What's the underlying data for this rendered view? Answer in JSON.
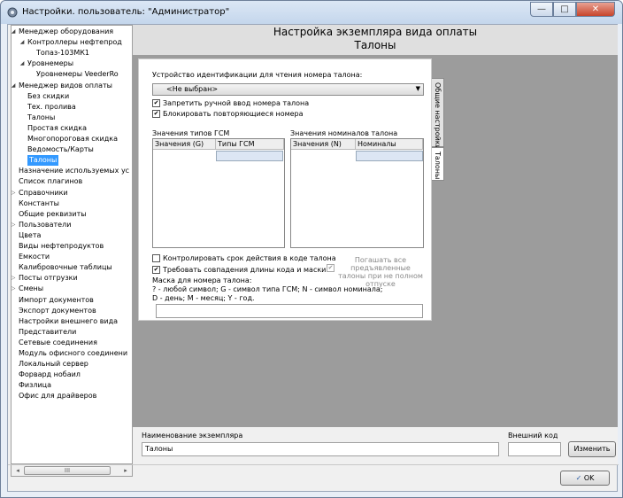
{
  "window": {
    "title": "Настройки. пользователь: \"Администратор\""
  },
  "tree": {
    "items": [
      {
        "label": "Менеджер оборудования",
        "level": 0,
        "twisty": "◢"
      },
      {
        "label": "Контроллеры нефтепрод",
        "level": 1,
        "twisty": "◢"
      },
      {
        "label": "Топаз-103МК1",
        "level": 2,
        "twisty": ""
      },
      {
        "label": "Уровнемеры",
        "level": 1,
        "twisty": "◢"
      },
      {
        "label": "Уровнемеры VeederRo",
        "level": 2,
        "twisty": ""
      },
      {
        "label": "Менеджер видов оплаты",
        "level": 0,
        "twisty": "◢"
      },
      {
        "label": "Без скидки",
        "level": 1,
        "twisty": ""
      },
      {
        "label": "Тех. пролива",
        "level": 1,
        "twisty": ""
      },
      {
        "label": "Талоны",
        "level": 1,
        "twisty": ""
      },
      {
        "label": "Простая скидка",
        "level": 1,
        "twisty": ""
      },
      {
        "label": "Многопороговая скидка",
        "level": 1,
        "twisty": ""
      },
      {
        "label": "Ведомость/Карты",
        "level": 1,
        "twisty": ""
      },
      {
        "label": "Талоны",
        "level": 1,
        "twisty": "",
        "selected": true
      },
      {
        "label": "Назначение используемых ус",
        "level": 0,
        "twisty": ""
      },
      {
        "label": "Список плагинов",
        "level": 0,
        "twisty": ""
      },
      {
        "label": "Справочники",
        "level": 0,
        "twisty": "▷"
      },
      {
        "label": "Константы",
        "level": 0,
        "twisty": ""
      },
      {
        "label": "Общие реквизиты",
        "level": 0,
        "twisty": ""
      },
      {
        "label": "Пользователи",
        "level": 0,
        "twisty": "▷"
      },
      {
        "label": "Цвета",
        "level": 0,
        "twisty": ""
      },
      {
        "label": "Виды нефтепродуктов",
        "level": 0,
        "twisty": ""
      },
      {
        "label": "Емкости",
        "level": 0,
        "twisty": ""
      },
      {
        "label": "Калибровочные таблицы",
        "level": 0,
        "twisty": ""
      },
      {
        "label": "Посты отгрузки",
        "level": 0,
        "twisty": "▷"
      },
      {
        "label": "Смены",
        "level": 0,
        "twisty": "▷"
      },
      {
        "label": "Импорт документов",
        "level": 0,
        "twisty": ""
      },
      {
        "label": "Экспорт документов",
        "level": 0,
        "twisty": ""
      },
      {
        "label": "Настройки внешнего вида",
        "level": 0,
        "twisty": ""
      },
      {
        "label": "Представители",
        "level": 0,
        "twisty": ""
      },
      {
        "label": "Сетевые соединения",
        "level": 0,
        "twisty": ""
      },
      {
        "label": "Модуль офисного соединени",
        "level": 0,
        "twisty": ""
      },
      {
        "label": "Локальный сервер",
        "level": 0,
        "twisty": ""
      },
      {
        "label": "Форвард нобаил",
        "level": 0,
        "twisty": ""
      },
      {
        "label": "Физлица",
        "level": 0,
        "twisty": ""
      },
      {
        "label": "Офис для драйверов",
        "level": 0,
        "twisty": ""
      }
    ],
    "scroll_thumb": "III"
  },
  "header": {
    "title": "Настройка экземпляра вида оплаты",
    "subtitle": "Талоны"
  },
  "tabs": [
    {
      "label": "Общие настройки",
      "active": false
    },
    {
      "label": "Талоны",
      "active": true
    }
  ],
  "form": {
    "device_label": "Устройство идентификации для чтения номера талона:",
    "device_value": "<Не выбран>",
    "forbid_manual": {
      "label": "Запретить ручной ввод номера талона",
      "checked": true
    },
    "block_repeat": {
      "label": "Блокировать повторяющиеся номера",
      "checked": true
    },
    "gsm_types": {
      "title": "Значения типов ГСМ",
      "col1": "Значения (G)",
      "col2": "Типы ГСМ"
    },
    "nominals": {
      "title": "Значения номиналов талона",
      "col1": "Значения (N)",
      "col2": "Номиналы талона"
    },
    "control_expiry": {
      "label": "Контролировать срок действия в коде талона",
      "checked": false
    },
    "require_length": {
      "label": "Требовать совпадения длины кода и маски",
      "checked": true
    },
    "repay_all": {
      "label": "Погашать все предъявленные талоны при не полном отпуске",
      "checked": true,
      "disabled": true
    },
    "mask_label": "Маска для номера талона:",
    "mask_help1": "? - любой символ; G - символ типа ГСМ; N - символ номинала;",
    "mask_help2": "D - день; M - месяц; Y - год."
  },
  "instance": {
    "name_label": "Наименование экземпляра",
    "name_value": "Талоны",
    "ext_code_label": "Внешний код",
    "ext_code_value": "",
    "change_button": "Изменить"
  },
  "ok_button": "OK",
  "win_buttons": {
    "minimize": "—",
    "maximize": "□",
    "close": "✕"
  }
}
